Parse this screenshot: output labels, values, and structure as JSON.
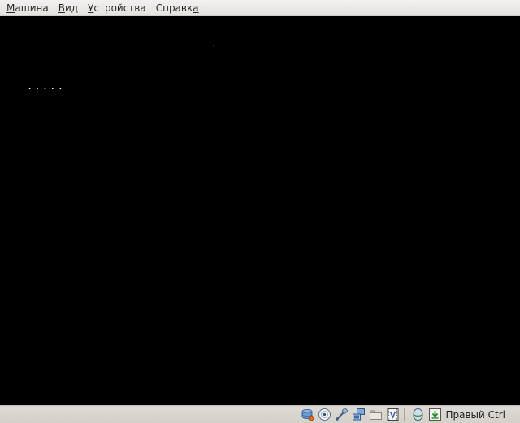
{
  "menubar": {
    "items": [
      {
        "pre": "",
        "acc": "М",
        "post": "ашина"
      },
      {
        "pre": "",
        "acc": "В",
        "post": "ид"
      },
      {
        "pre": "",
        "acc": "У",
        "post": "стройства"
      },
      {
        "pre": "Справк",
        "acc": "а",
        "post": ""
      }
    ]
  },
  "screen": {
    "boot_text": "....."
  },
  "statusbar": {
    "icons": [
      "hard-disk-icon",
      "optical-drive-icon",
      "usb-icon",
      "network-icon",
      "shared-folders-icon",
      "video-capture-icon",
      "mouse-integration-icon",
      "keyboard-capture-icon"
    ],
    "host_key_label": "Правый Ctrl"
  }
}
